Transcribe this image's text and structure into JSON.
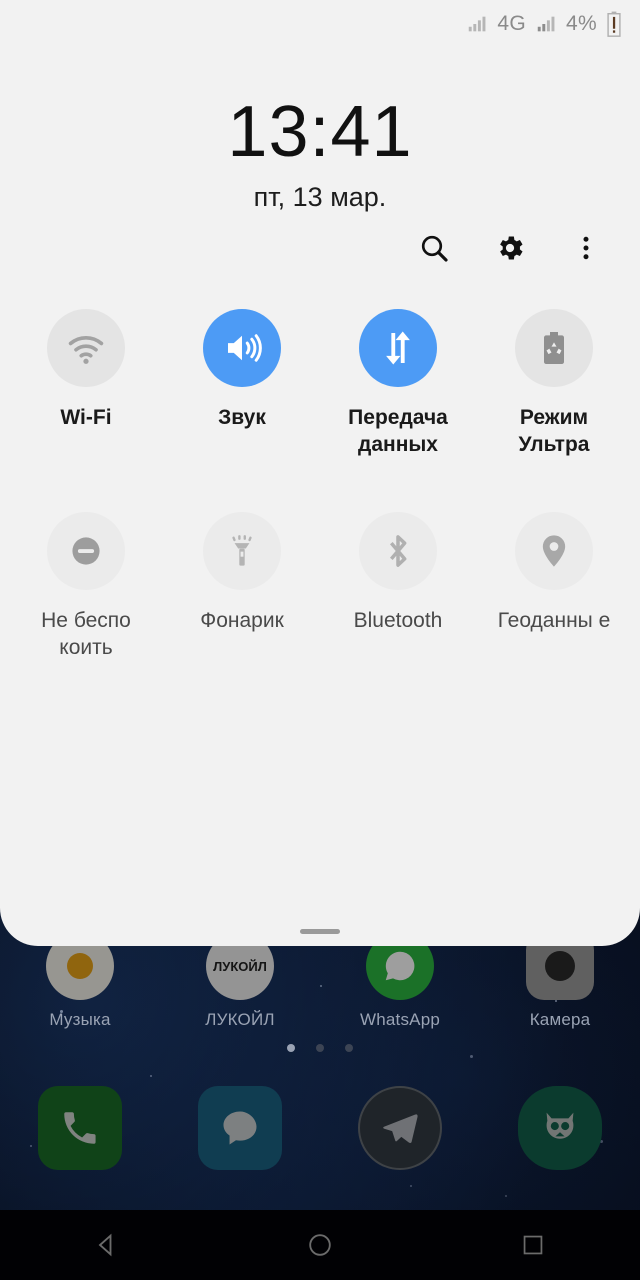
{
  "statusbar": {
    "signal_left_icon": "signal-bars-icon",
    "network_type": "4G",
    "signal_right_icon": "signal-bars-icon",
    "battery_percent": "4%",
    "battery_icon": "battery-low-alert-icon"
  },
  "panel": {
    "clock": "13:41",
    "date": "пт, 13 мар.",
    "actions": [
      {
        "name": "search-button",
        "icon": "search-icon"
      },
      {
        "name": "settings-button",
        "icon": "gear-icon"
      },
      {
        "name": "overflow-menu-button",
        "icon": "more-vertical-icon"
      }
    ],
    "accent_on_color": "#4d9bf5",
    "tile_off_color": "#e4e4e4",
    "tiles_row1": [
      {
        "label": "Wi-Fi",
        "icon": "wifi-icon",
        "state": "off",
        "dim": false
      },
      {
        "label": "Звук",
        "icon": "volume-up-icon",
        "state": "on",
        "dim": false
      },
      {
        "label": "Передача данных",
        "icon": "data-transfer-icon",
        "state": "on",
        "dim": false
      },
      {
        "label": "Режим Ультра",
        "icon": "battery-saver-icon",
        "state": "off",
        "dim": false
      }
    ],
    "tiles_row2": [
      {
        "label": "Не беспо коить",
        "icon": "do-not-disturb-icon",
        "state": "off",
        "dim": true
      },
      {
        "label": "Фонарик",
        "icon": "flashlight-icon",
        "state": "off",
        "dim": true
      },
      {
        "label": "Bluetooth",
        "icon": "bluetooth-icon",
        "state": "off",
        "dim": true
      },
      {
        "label": "Геоданны е",
        "icon": "location-pin-icon",
        "state": "off",
        "dim": true
      }
    ],
    "drag_handle": "panel-drag-handle"
  },
  "home": {
    "apps": [
      {
        "label": "Музыка",
        "icon": "music-app-icon"
      },
      {
        "label": "ЛУКОЙЛ",
        "icon": "lukoil-app-icon"
      },
      {
        "label": "WhatsApp",
        "icon": "whatsapp-app-icon"
      },
      {
        "label": "Камера",
        "icon": "camera-app-icon"
      }
    ],
    "page_dots": {
      "count": 3,
      "active_index": 0
    },
    "dock": [
      {
        "name": "phone",
        "icon": "phone-icon"
      },
      {
        "name": "messages",
        "icon": "message-bubble-icon"
      },
      {
        "name": "telegram",
        "icon": "telegram-icon"
      },
      {
        "name": "owl-app",
        "icon": "owl-icon"
      }
    ]
  },
  "navbar": [
    {
      "name": "back-button",
      "icon": "triangle-back-icon"
    },
    {
      "name": "home-button",
      "icon": "circle-home-icon"
    },
    {
      "name": "recents-button",
      "icon": "square-recents-icon"
    }
  ]
}
